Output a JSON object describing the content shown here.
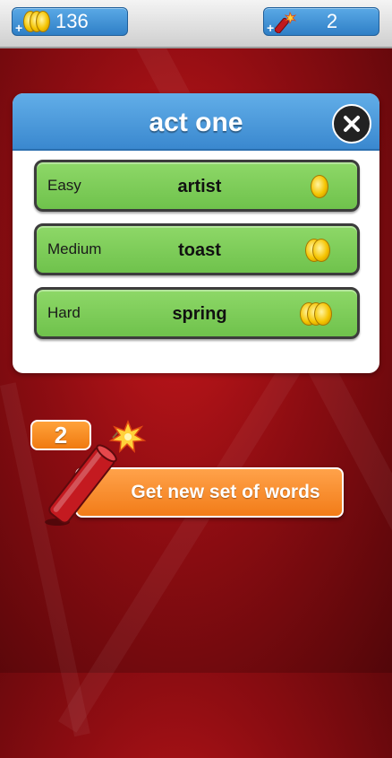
{
  "top_bar": {
    "coins": {
      "value": "136",
      "icon": "coins-icon",
      "add_icon": "plus-icon"
    },
    "firecrackers": {
      "value": "2",
      "icon": "firecracker-icon",
      "add_icon": "plus-icon"
    }
  },
  "dialog": {
    "title": "act one",
    "close_icon": "close-icon",
    "options": [
      {
        "level": "Easy",
        "word": "artist",
        "coins": 1
      },
      {
        "level": "Medium",
        "word": "toast",
        "coins": 2
      },
      {
        "level": "Hard",
        "word": "spring",
        "coins": 3
      }
    ]
  },
  "powerup": {
    "count": "2",
    "button_label": "Get new set of words",
    "icon": "firecracker-icon"
  },
  "colors": {
    "background": "#b3141a",
    "header_blue": "#4a96da",
    "option_green": "#7ccb57",
    "button_orange": "#f58a24"
  }
}
